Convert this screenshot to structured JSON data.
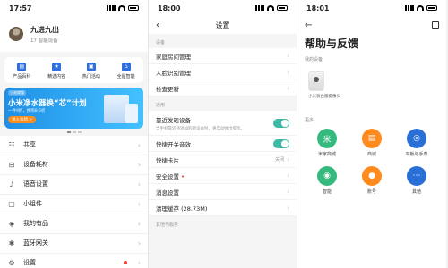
{
  "panels": [
    {
      "time": "17:57",
      "profile": {
        "name": "九进九出",
        "subtitle": "17 智能设备"
      },
      "shortcuts": [
        {
          "label": "产品百科",
          "icon": "book-icon"
        },
        {
          "label": "精选内容",
          "icon": "star-icon"
        },
        {
          "label": "热门活动",
          "icon": "gift-icon"
        },
        {
          "label": "全屋智能",
          "icon": "home-icon"
        }
      ],
      "banner": {
        "tag": "小米商城",
        "title": "小米净水器换“芯”计划",
        "sub": "一件9折，换购8.5折",
        "cta": "进入会场 >"
      },
      "menu": [
        {
          "label": "共享",
          "icon": "share-icon"
        },
        {
          "label": "设备耗材",
          "icon": "consumables-icon"
        },
        {
          "label": "语音设置",
          "icon": "mic-icon"
        },
        {
          "label": "小组件",
          "icon": "widget-icon"
        },
        {
          "label": "我的有品",
          "icon": "shop-icon"
        },
        {
          "label": "蓝牙网关",
          "icon": "bluetooth-icon"
        },
        {
          "label": "设置",
          "icon": "gear-icon"
        }
      ]
    },
    {
      "time": "18:00",
      "title": "设置",
      "section_device": "设备",
      "device_rows": [
        "家庭房间管理",
        "人脸识别管理",
        "检查更新"
      ],
      "section_general": "通用",
      "discover": {
        "title": "靠近发现设备",
        "desc": "当手机靠近待添加的新设备时，将自动弹出提示。"
      },
      "general_rows": [
        {
          "label": "快捷开关音效",
          "type": "toggle"
        },
        {
          "label": "快捷卡片",
          "type": "value",
          "value": "关闭"
        },
        {
          "label": "安全设置",
          "type": "alert"
        },
        {
          "label": "消息设置",
          "type": "chevron"
        },
        {
          "label": "清理缓存 (28.73M)",
          "type": "chevron"
        }
      ],
      "section_other": "其他与服务"
    },
    {
      "time": "18:01",
      "title": "帮助与反馈",
      "my_devices": "我的设备",
      "device_name": "小米云台版摄像头",
      "more": "更多",
      "grid": [
        {
          "label": "米家商城",
          "icon": "mijia-icon",
          "color": "#35b97f"
        },
        {
          "label": "商城",
          "icon": "cart-icon",
          "color": "#ff8a1e"
        },
        {
          "label": "平板与手表",
          "icon": "tablet-icon",
          "color": "#2a6fd6"
        },
        {
          "label": "智能",
          "icon": "smart-icon",
          "color": "#35b97f"
        },
        {
          "label": "账号",
          "icon": "account-icon",
          "color": "#ff8a1e"
        },
        {
          "label": "其他",
          "icon": "more-icon",
          "color": "#2a6fd6"
        }
      ]
    }
  ]
}
